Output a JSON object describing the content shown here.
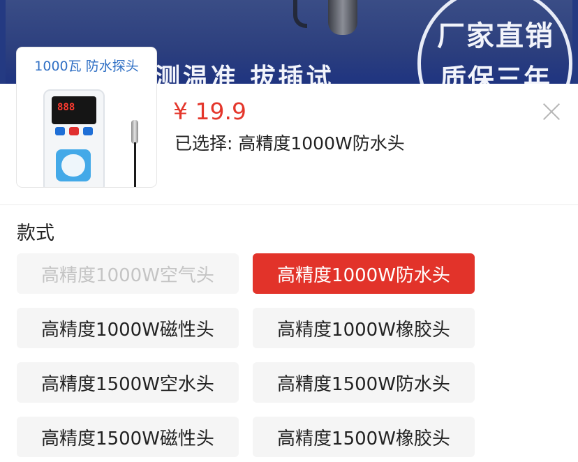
{
  "banner": {
    "circle_line1": "厂家直销",
    "circle_line2": "质保三年",
    "slogan": "测温准 拔插试"
  },
  "product": {
    "thumbnail_label": "1000瓦  防水探头",
    "display_digits": "888",
    "price": "¥ 19.9",
    "selected_text": "已选择: 高精度1000W防水头"
  },
  "section": {
    "title": "款式"
  },
  "options": [
    {
      "label": "高精度1000W空气头",
      "state": "disabled"
    },
    {
      "label": "高精度1000W防水头",
      "state": "selected"
    },
    {
      "label": "高精度1000W磁性头",
      "state": "normal"
    },
    {
      "label": "高精度1000W橡胶头",
      "state": "normal"
    },
    {
      "label": "高精度1500W空水头",
      "state": "normal"
    },
    {
      "label": "高精度1500W防水头",
      "state": "normal"
    },
    {
      "label": "高精度1500W磁性头",
      "state": "normal"
    },
    {
      "label": "高精度1500W橡胶头",
      "state": "normal"
    }
  ],
  "colors": {
    "accent": "#e2332a",
    "price": "#e4362b",
    "option_bg": "#f5f5f5",
    "disabled_text": "#c4c4c4"
  }
}
